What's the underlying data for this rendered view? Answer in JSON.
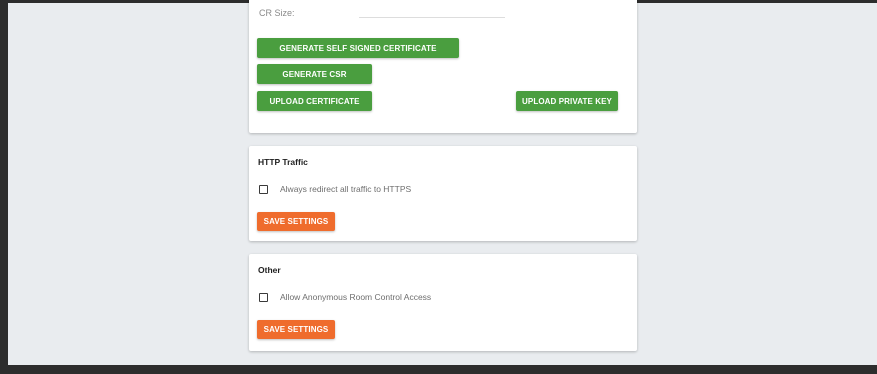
{
  "certificate": {
    "cut_field_label": "CR Size:",
    "buttons": {
      "generate_self_signed": "GENERATE SELF SIGNED CERTIFICATE",
      "generate_csr": "GENERATE CSR",
      "upload_certificate": "UPLOAD CERTIFICATE",
      "upload_private_key": "UPLOAD PRIVATE KEY"
    }
  },
  "http_traffic": {
    "title": "HTTP Traffic",
    "checkbox_label": "Always redirect all traffic to HTTPS",
    "checked": false,
    "save_label": "SAVE SETTINGS"
  },
  "other": {
    "title": "Other",
    "checkbox_label": "Allow Anonymous Room Control Access",
    "checked": false,
    "save_label": "SAVE SETTINGS"
  },
  "colors": {
    "primary_green": "#4a9e3f",
    "accent_orange": "#ef6c2d",
    "page_background": "#e9ecef",
    "frame_dark": "#2d2d2d"
  }
}
